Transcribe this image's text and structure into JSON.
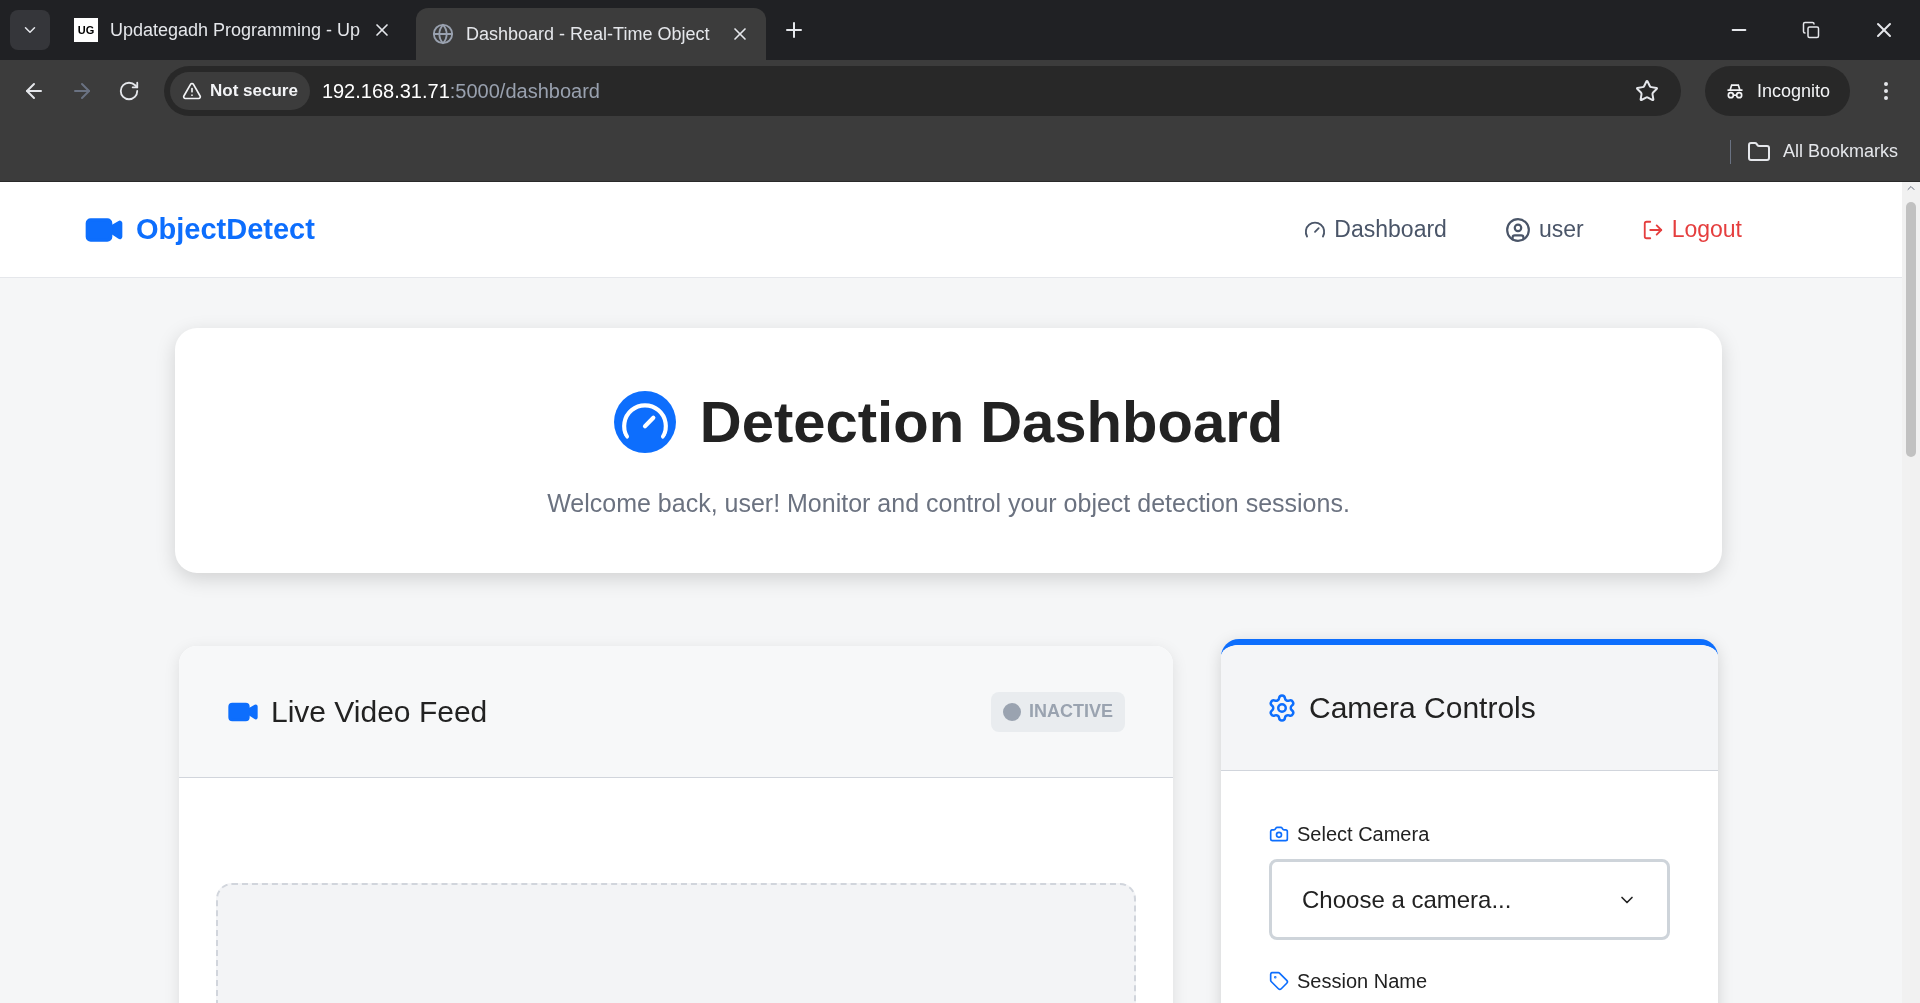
{
  "browser": {
    "tabs": [
      {
        "title": "Updategadh Programming - Up",
        "favicon": "UG",
        "selected": false
      },
      {
        "title": "Dashboard - Real-Time Object",
        "selected": true
      }
    ],
    "security": "Not secure",
    "url_host": "192.168.31.71",
    "url_path": ":5000/dashboard",
    "profile": "Incognito",
    "bookmarks": "All Bookmarks"
  },
  "navbar": {
    "brand": "ObjectDetect",
    "links": [
      {
        "label": "Dashboard",
        "kind": "dashboard"
      },
      {
        "label": "user",
        "kind": "user"
      },
      {
        "label": "Logout",
        "kind": "logout"
      }
    ]
  },
  "hero": {
    "title": "Detection Dashboard",
    "subtitle": "Welcome back, user! Monitor and control your object detection sessions."
  },
  "video_card": {
    "title": "Live Video Feed",
    "status": "INACTIVE",
    "active": false
  },
  "controls_card": {
    "title": "Camera Controls",
    "fields": [
      {
        "label": "Select Camera",
        "kind": "select",
        "placeholder": "Choose a camera..."
      },
      {
        "label": "Session Name",
        "kind": "text"
      }
    ]
  }
}
